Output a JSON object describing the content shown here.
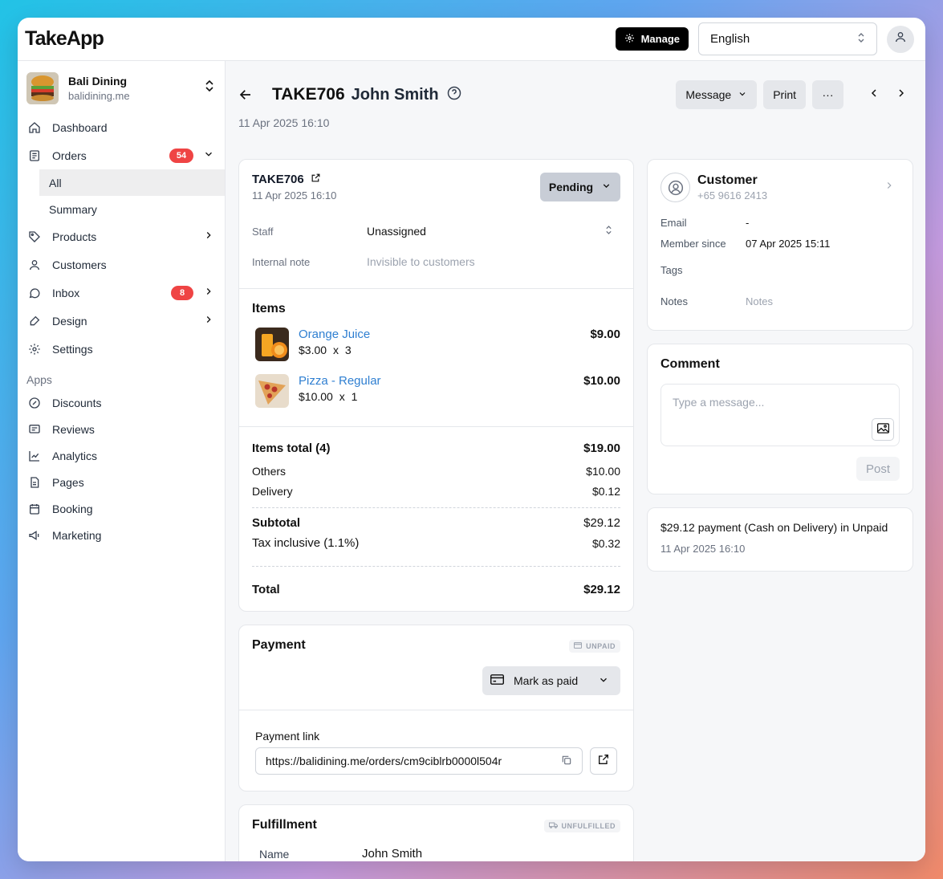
{
  "app": {
    "logo": "TakeApp"
  },
  "topbar": {
    "manage_label": "Manage",
    "language": "English"
  },
  "store": {
    "name": "Bali Dining",
    "url": "balidining.me"
  },
  "nav": {
    "dashboard": "Dashboard",
    "orders": "Orders",
    "orders_badge": "54",
    "orders_all": "All",
    "orders_summary": "Summary",
    "products": "Products",
    "customers": "Customers",
    "inbox": "Inbox",
    "inbox_badge": "8",
    "design": "Design",
    "settings": "Settings"
  },
  "apps": {
    "label": "Apps",
    "discounts": "Discounts",
    "reviews": "Reviews",
    "analytics": "Analytics",
    "pages": "Pages",
    "booking": "Booking",
    "marketing": "Marketing"
  },
  "header": {
    "order_id": "TAKE706",
    "customer_name": "John Smith",
    "date": "11 Apr 2025 16:10",
    "message_label": "Message",
    "print_label": "Print",
    "more_label": "···"
  },
  "order": {
    "id": "TAKE706",
    "date": "11 Apr 2025 16:10",
    "status": "Pending",
    "staff_label": "Staff",
    "staff_value": "Unassigned",
    "note_label": "Internal note",
    "note_placeholder": "Invisible to customers"
  },
  "items": {
    "title": "Items",
    "list": [
      {
        "name": "Orange Juice",
        "unit_price": "$3.00",
        "x": "x",
        "qty": "3",
        "total": "$9.00"
      },
      {
        "name": "Pizza - Regular",
        "unit_price": "$10.00",
        "x": "x",
        "qty": "1",
        "total": "$10.00"
      }
    ]
  },
  "totals": {
    "items_total_label": "Items total (4)",
    "items_total": "$19.00",
    "others_label": "Others",
    "others": "$10.00",
    "delivery_label": "Delivery",
    "delivery": "$0.12",
    "subtotal_label": "Subtotal",
    "subtotal": "$29.12",
    "tax_label": "Tax inclusive (1.1%)",
    "tax": "$0.32",
    "total_label": "Total",
    "total": "$29.12"
  },
  "payment": {
    "title": "Payment",
    "status": "UNPAID",
    "mark_paid_label": "Mark as paid",
    "link_label": "Payment link",
    "link_value": "https://balidining.me/orders/cm9ciblrb0000l504r"
  },
  "fulfillment": {
    "title": "Fulfillment",
    "status": "UNFULFILLED",
    "name_label": "Name",
    "name_value": "John Smith"
  },
  "customer": {
    "title": "Customer",
    "phone": "+65 9616 2413",
    "email_label": "Email",
    "email_value": "-",
    "member_label": "Member since",
    "member_value": "07 Apr 2025 15:11",
    "tags_label": "Tags",
    "notes_label": "Notes",
    "notes_placeholder": "Notes"
  },
  "comment": {
    "title": "Comment",
    "placeholder": "Type a message...",
    "post_label": "Post"
  },
  "payment_log": {
    "text": "$29.12 payment (Cash on Delivery) in Unpaid",
    "date": "11 Apr 2025 16:10"
  },
  "colors": {
    "accent_link": "#2f7fd1",
    "badge": "#ef4444",
    "pending_bg": "#c8cdd6"
  }
}
